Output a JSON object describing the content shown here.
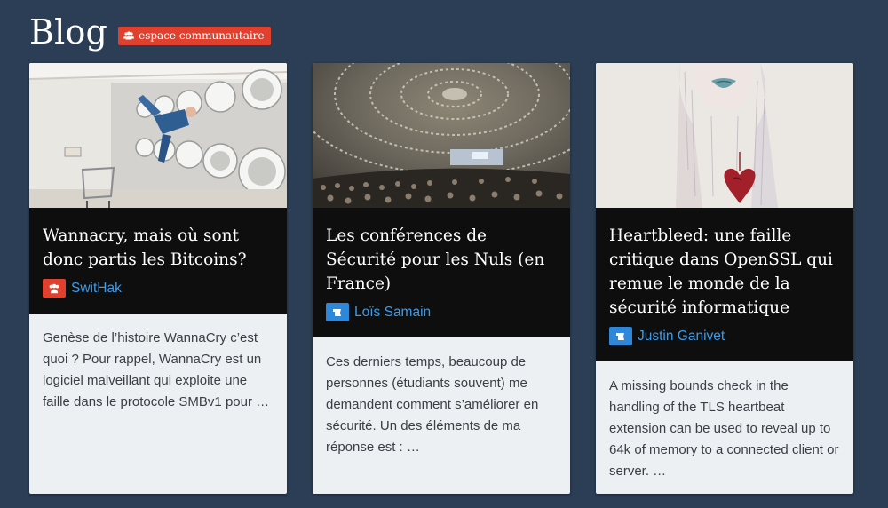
{
  "header": {
    "title": "Blog",
    "badge_label": "espace communautaire",
    "badge_icon": "users-icon"
  },
  "colors": {
    "background": "#2c3e55",
    "badge": "#e0412f",
    "author_link": "#3d9be9",
    "author_icon_red": "#e0412f",
    "author_icon_blue": "#2e87d8"
  },
  "posts": [
    {
      "image": "laundromat-photo",
      "title": "Wannacry, mais où sont donc partis les Bitcoins?",
      "author": "SwitHak",
      "author_icon": "users-icon",
      "excerpt": "Genèse de l’histoire WannaCry c’est quoi ? Pour rappel, WannaCry est un logiciel malveillant qui exploite une faille dans le protocole SMBv1 pour …"
    },
    {
      "image": "conference-hall-photo",
      "title": "Les conférences de Sécurité pour les Nuls (en France)",
      "author": "Loïs Samain",
      "author_icon": "flag-icon",
      "excerpt": "Ces derniers temps, beaucoup de personnes (étudiants souvent) me demandent comment s’améliorer en sécurité. Un des éléments de ma réponse est : …"
    },
    {
      "image": "bleeding-heart-painting",
      "title": "Heartbleed: une faille critique dans OpenSSL qui remue le monde de la sécurité informatique",
      "author": "Justin Ganivet",
      "author_icon": "flag-icon",
      "excerpt": "A missing bounds check in the handling of the TLS heartbeat extension can be used to reveal up to 64k of memory to a connected client or server. …"
    }
  ]
}
